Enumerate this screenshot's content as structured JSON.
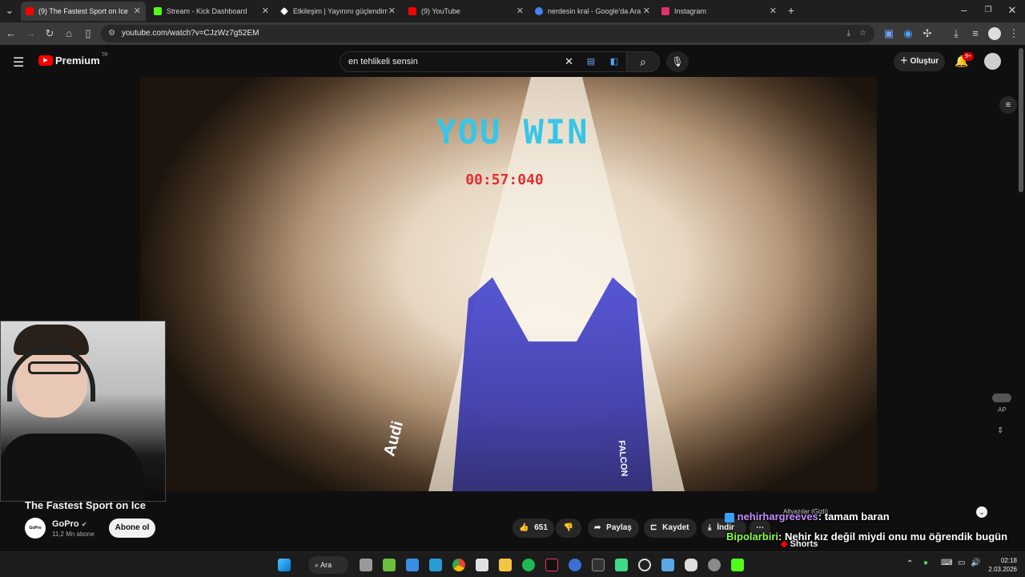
{
  "tabs": [
    {
      "title": "(9) The Fastest Sport on Ice",
      "color": "#ff0000",
      "active": true
    },
    {
      "title": "Stream - Kick Dashboard",
      "color": "#53fc18"
    },
    {
      "title": "Etkileşim | Yayınını güçlendirme",
      "color": "#ffffff"
    },
    {
      "title": "(9) YouTube",
      "color": "#ff0000"
    },
    {
      "title": "nerdesin kral - Google'da Ara",
      "color": "#4285f4"
    },
    {
      "title": "Instagram",
      "color": "#e1306c"
    }
  ],
  "address": "youtube.com/watch?v=CJzWz7g52EM",
  "youtube": {
    "logo": "Premium",
    "region": "TR",
    "search_query": "en tehlikeli sensin",
    "create_label": "Oluştur",
    "notif_count": "9+"
  },
  "video": {
    "overlay_text": "YOU WIN",
    "timer": "00:57:040",
    "brand_left": "Audi",
    "brand_right": "FALCON",
    "autoplay_label": "AP"
  },
  "meta": {
    "title": "The Fastest Sport on Ice",
    "channel": "GoPro",
    "subscribers": "11,2 Mn abone",
    "subscribe_label": "Abone ol",
    "likes": "651",
    "share_label": "Paylaş",
    "save_label": "Kaydet",
    "download_label": "İndir",
    "subtitles_label": "Altyazılar (Gizli)",
    "shorts_label": "Shorts"
  },
  "chat": [
    {
      "user": "nehirhargreeves",
      "message": ": tamam baran",
      "color": "#c78bff"
    },
    {
      "user": "Bipolarbiri",
      "message": ": Nehir kız değil miydi onu mu öğrendik bugün",
      "color": "#8cff4d"
    }
  ],
  "taskbar": {
    "search_label": "Ara",
    "time": "02:18",
    "date": "2.03.2026"
  }
}
